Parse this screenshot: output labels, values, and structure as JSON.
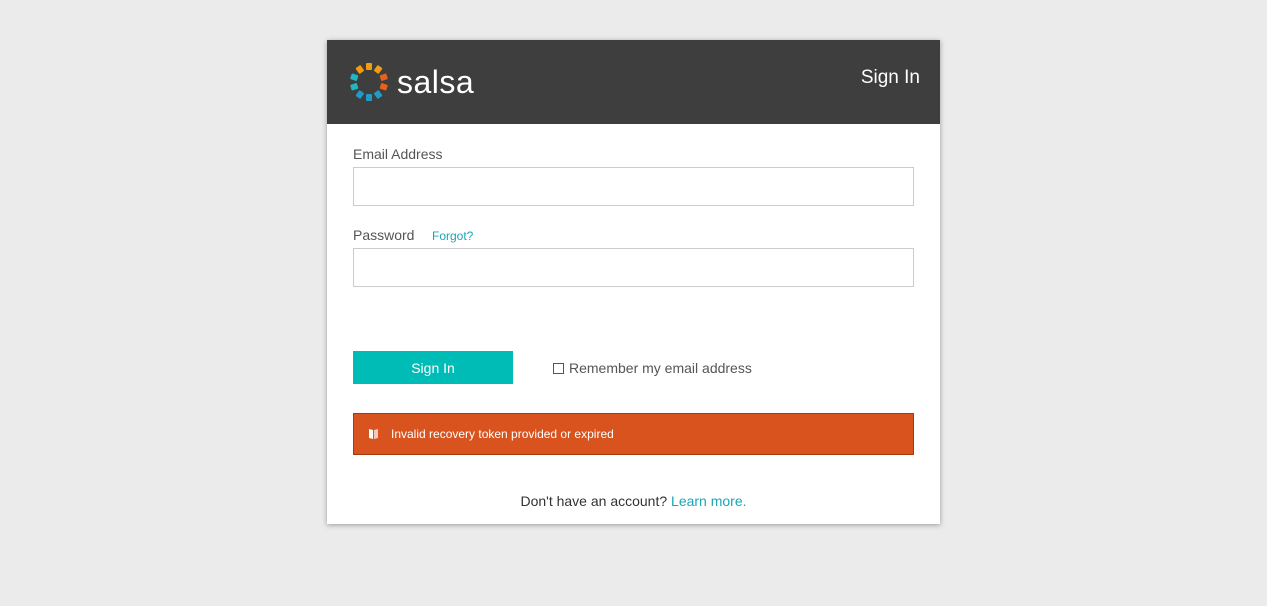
{
  "brand": {
    "name": "salsa",
    "logo_icon": "salsa-sunburst-logo"
  },
  "header": {
    "title": "Sign In"
  },
  "form": {
    "email": {
      "label": "Email Address",
      "value": "",
      "placeholder": ""
    },
    "password": {
      "label": "Password",
      "value": "",
      "placeholder": "",
      "forgot_label": "Forgot?"
    },
    "submit_label": "Sign In",
    "remember": {
      "label": "Remember my email address",
      "checked": false
    }
  },
  "alert": {
    "icon": "book-icon",
    "message": "Invalid recovery token provided or expired",
    "color": "#d9531e"
  },
  "signup": {
    "prompt": "Don't have an account?",
    "link_label": "Learn more."
  },
  "colors": {
    "accent": "#00bcb6",
    "link": "#1aa6b7",
    "header_bg": "#3e3e3e",
    "page_bg": "#ebebeb"
  }
}
